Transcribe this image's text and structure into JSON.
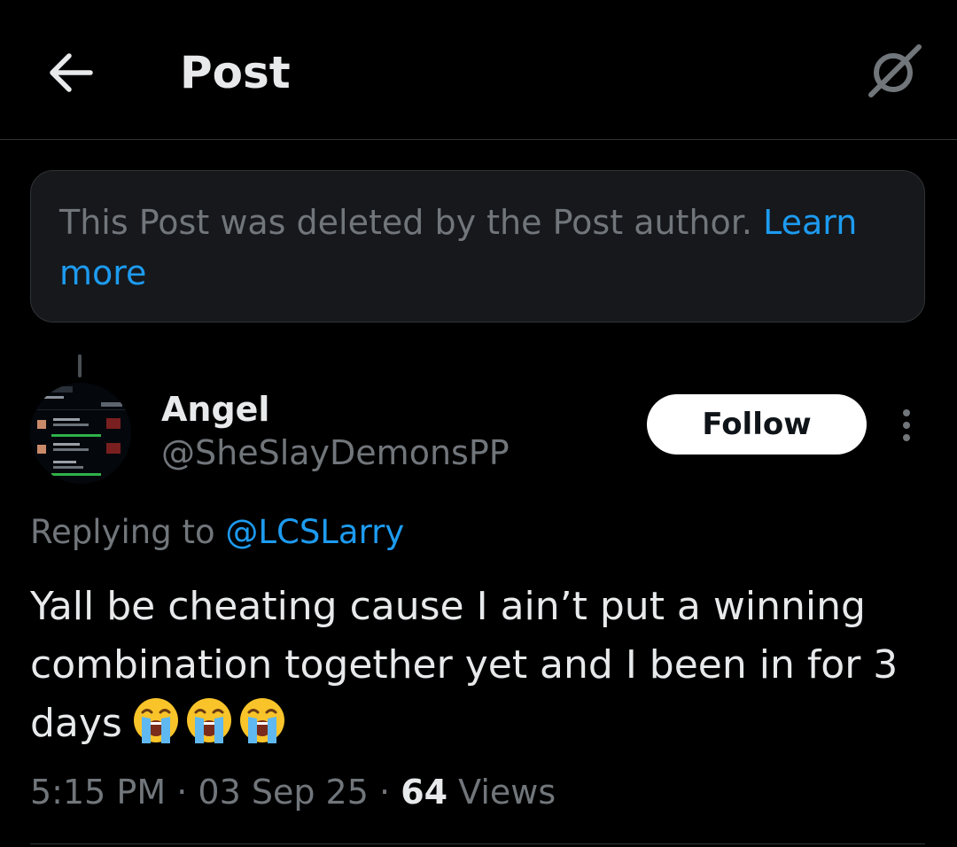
{
  "header": {
    "title": "Post",
    "back_icon": "arrow-left-icon",
    "grok_icon": "grok-icon"
  },
  "deleted_notice": {
    "text": "This Post was deleted by the Post author.",
    "link": "Learn more"
  },
  "post": {
    "display_name": "Angel",
    "handle": "@SheSlayDemonsPP",
    "follow_label": "Follow",
    "replying_prefix": "Replying to",
    "replying_to": "@LCSLarry",
    "text": "Yall be cheating cause I ain’t put a winning combination together yet and I been in for 3 days",
    "emojis": [
      "loudly-crying-face",
      "loudly-crying-face",
      "loudly-crying-face"
    ],
    "time": "5:15 PM",
    "date": "03 Sep 25",
    "views_count": "64",
    "views_label": "Views"
  },
  "colors": {
    "background": "#000000",
    "notice_background": "#16181c",
    "link": "#1d9bf0",
    "muted_text": "#71767b",
    "primary_text": "#e7e9ea"
  }
}
